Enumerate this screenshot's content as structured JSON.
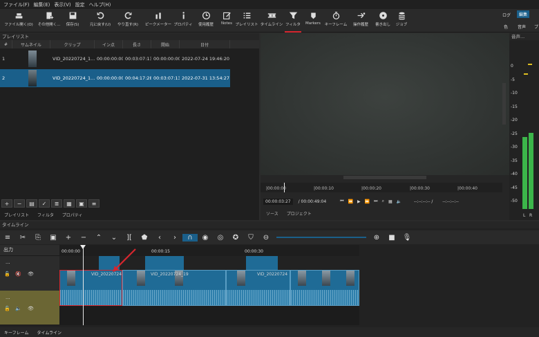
{
  "menubar": {
    "items": [
      "ファイル(F)",
      "編集(E)",
      "表示(V)",
      "設定",
      "ヘルプ(H)"
    ]
  },
  "toolbar": {
    "items": [
      {
        "label": "ファイル開く(O)",
        "icon": "tray-icon"
      },
      {
        "label": "その他開く...",
        "icon": "file-plus-icon"
      },
      {
        "label": "保存(S)",
        "icon": "save-icon"
      },
      {
        "label": "元に戻す(U)",
        "icon": "undo-icon"
      },
      {
        "label": "やり直す(R)",
        "icon": "redo-icon"
      },
      {
        "label": "ピークメーター",
        "icon": "meter-icon"
      },
      {
        "label": "プロパティ",
        "icon": "info-icon"
      },
      {
        "label": "使用履歴",
        "icon": "clock-icon"
      },
      {
        "label": "Notes",
        "icon": "notes-icon"
      },
      {
        "label": "プレイリスト",
        "icon": "list-icon"
      },
      {
        "label": "タイムライン",
        "icon": "timeline-icon"
      },
      {
        "label": "フィルタ",
        "icon": "filter-icon"
      },
      {
        "label": "Markers",
        "icon": "marker-icon"
      },
      {
        "label": "キーフレーム",
        "icon": "stopwatch-icon"
      },
      {
        "label": "操作履歴",
        "icon": "history-icon"
      },
      {
        "label": "書き出し",
        "icon": "disc-icon"
      },
      {
        "label": "ジョブ",
        "icon": "stack-icon"
      }
    ],
    "layout_labels": [
      "ログ",
      "編集"
    ],
    "layout_sub": [
      "色",
      "音声",
      "プ"
    ]
  },
  "playlist": {
    "title": "プレイリスト",
    "columns": [
      "#",
      "サムネイル",
      "クリップ",
      "イン点",
      "長さ",
      "開始",
      "日付"
    ],
    "rows": [
      {
        "num": "1",
        "clip": "VID_20220724_1...",
        "in": "00:00:00:00",
        "duration": "00:03:07:13",
        "start": "00:00:00:00",
        "date": "2022-07-24 19:46:20"
      },
      {
        "num": "2",
        "clip": "VID_20220724_1...",
        "in": "00:00:00:00",
        "duration": "00:04:17:28",
        "start": "00:03:07:13",
        "date": "2022-07-31 13:54:27"
      }
    ],
    "tabs": [
      "プレイリスト",
      "フィルタ",
      "プロパティ"
    ]
  },
  "viewer": {
    "ruler_labels": [
      "|00:00:00",
      "|00:00:10",
      "|00:00:20",
      "|00:00:30",
      "|00:00:40"
    ],
    "timecode": "00:00:03:27",
    "total": "/ 00:00:49:04",
    "in_point": "--:--:--:-- /",
    "out_point": "--:--:--:--",
    "tabs": [
      "ソース",
      "プロジェクト"
    ]
  },
  "meter": {
    "title": "音声...",
    "scale": [
      "0",
      "-5",
      "-10",
      "-15",
      "-20",
      "-25",
      "-30",
      "-35",
      "-40",
      "-45",
      "-50"
    ],
    "channels": [
      "L",
      "R"
    ],
    "levels": [
      0.52,
      0.55
    ]
  },
  "timeline": {
    "title": "タイムライン",
    "ruler_labels": [
      "00:00:00",
      "00:00:15",
      "00:00:30"
    ],
    "output_label": "出力",
    "track1_label": "...",
    "track2_label": "...",
    "clip_labels": [
      "VID_20220724",
      "VID_20220724_19",
      "VID_20220724"
    ],
    "bottom_tabs": [
      "キーフレーム",
      "タイムライン"
    ]
  },
  "colors": {
    "accent": "#1a5f8a",
    "clip": "#1f6b96",
    "annotation": "#d6262e",
    "track_highlight": "#6b6634"
  }
}
